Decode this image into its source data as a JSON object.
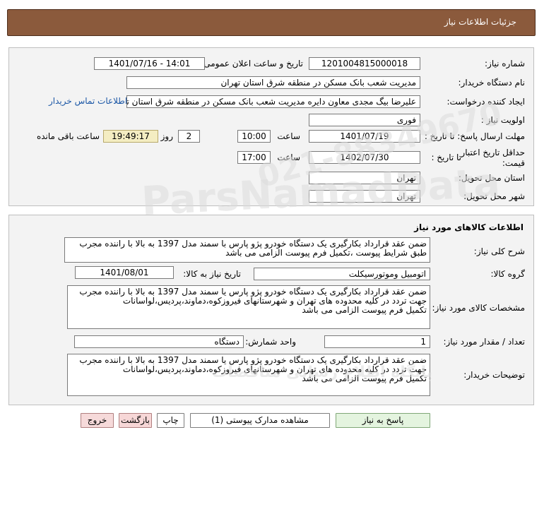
{
  "header": {
    "title": "جزئیات اطلاعات نیاز"
  },
  "info": {
    "need_number_label": "شماره نیاز:",
    "need_number": "1201004815000018",
    "announce_label": "تاریخ و ساعت اعلان عمومی:",
    "announce_value": "1401/07/16 - 14:01",
    "buyer_label": "نام دستگاه خریدار:",
    "buyer_value": "مدیریت شعب بانک مسکن در منطقه شرق استان تهران",
    "creator_label": "ایجاد کننده درخواست:",
    "creator_value": "علیرضا بیگ مجدی معاون دایره مدیریت شعب بانک مسکن در منطقه شرق استان تهران",
    "contact_link": "اطلاعات تماس خریدار",
    "priority_label": "اولویت نیاز :",
    "priority_value": "فوری",
    "deadline_label": "مهلت ارسال پاسخ: تا تاریخ :",
    "deadline_date": "1401/07/19",
    "time_label": "ساعت",
    "deadline_time": "10:00",
    "days_value": "2",
    "days_label": "روز و",
    "remaining_time": "19:49:17",
    "remaining_label": "ساعت باقی مانده",
    "validity_label_1": "حداقل تاریخ اعتبار",
    "validity_label_2": "قیمت:",
    "validity_to_label": "تا تاریخ :",
    "validity_date": "1402/07/30",
    "validity_time_label": "ساعت",
    "validity_time": "17:00",
    "province_label": "استان محل تحویل:",
    "province_value": "تهران",
    "city_label": "شهر محل تحویل:",
    "city_value": "تهران"
  },
  "goods": {
    "title": "اطلاعات کالاهای مورد نیاز",
    "general_label": "شرح کلی نیاز:",
    "general_value": "ضمن عقد قرارداد بکارگیری یک دستگاه خودرو پژو پارس با سمند مدل 1397 به بالا با راننده مجرب  طبق شرایط پیوست ،تکمیل فرم پیوست الزامی می باشد",
    "group_label": "گروه کالا:",
    "group_value": "اتومبیل وموتورسیکلت",
    "need_date_label": "تاریخ نیاز به کالا:",
    "need_date": "1401/08/01",
    "spec_label": "مشخصات کالای مورد نیاز:",
    "spec_lines": [
      "ضمن عقد قرارداد بکارگیری یک دستگاه خودرو پژو پارس یا سمند مدل 1397 به بالا با راننده مجرب",
      "جهت تردد در کلیه محدوده های تهران و شهرستانهای فیروزکوه،دماوند،پردیس،لواسانات",
      "تکمیل فرم پیوست الزامی می باشد"
    ],
    "qty_label": "تعداد / مقدار مورد نیاز:",
    "qty_value": "1",
    "unit_label": "واحد شمارش:",
    "unit_value": "دستگاه",
    "buyer_desc_label": "توضیحات خریدار:",
    "buyer_desc_lines": [
      "ضمن عقد قرارداد بکارگیری یک دستگاه خودرو پژو پارس یا سمند مدل 1397 به بالا با راننده مجرب",
      "جهت تردد در کلیه محدوده های تهران و شهرستانهای فیروزکوه،دماوند،پردیس،لواسانات",
      "تکمیل فرم پیوست الزامی می باشد"
    ]
  },
  "buttons": {
    "reply": "پاسخ به نیاز",
    "attachments": "مشاهده مدارک پیوستی (1)",
    "print": "چاپ",
    "back": "بازگشت",
    "exit": "خروج"
  },
  "watermark": {
    "line1": "ParsNamadData",
    "line2": "پایگاه اطلاع رسانی مناقصات",
    "line3": "021-88349670"
  }
}
